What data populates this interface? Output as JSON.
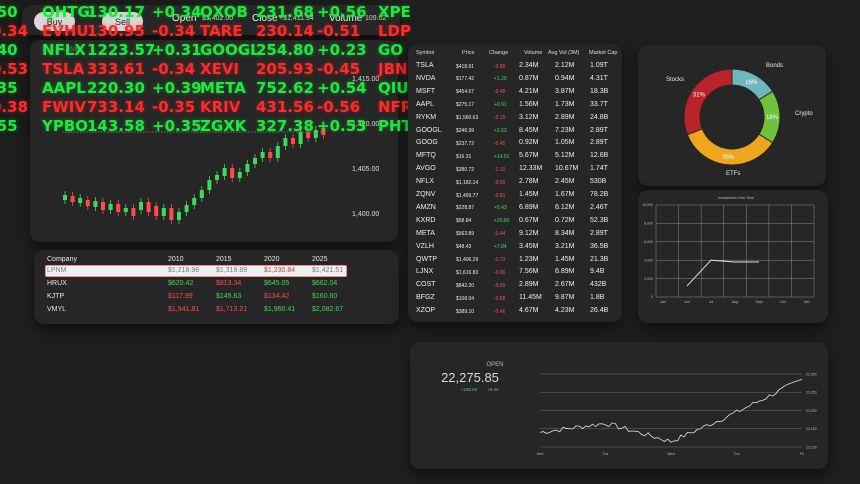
{
  "topbar": {
    "buy_label": "Buy",
    "sell_label": "Sell",
    "open_label": "Open",
    "open_value": "$1,402.00",
    "close_label": "Close",
    "close_value": "+$1,411.94",
    "volume_label": "Volume",
    "volume_value": "109.02"
  },
  "candle_chart": {
    "title": "LPNM",
    "price_ticks": [
      "1,415.00",
      "1,410.00",
      "1,405.00",
      "1,400.00"
    ]
  },
  "company_table": {
    "headers": [
      "Company",
      "2010",
      "2015",
      "2020",
      "2025"
    ],
    "rows": [
      {
        "name": "LPNM",
        "v": [
          "$1,218.98",
          "$1,319.89",
          "$1,230.84",
          "$1,421.51"
        ],
        "c": [
          "g",
          "g",
          "r",
          "g"
        ]
      },
      {
        "name": "HRUX",
        "v": [
          "$620.42",
          "$813.34",
          "$645.05",
          "$662.04"
        ],
        "c": [
          "g",
          "r",
          "g",
          "g"
        ]
      },
      {
        "name": "KJTP",
        "v": [
          "$117.99",
          "$145.63",
          "$134.42",
          "$160.60"
        ],
        "c": [
          "r",
          "g",
          "r",
          "g"
        ]
      },
      {
        "name": "VMYL",
        "v": [
          "$1,941.81",
          "$1,713.21",
          "$1,960.41",
          "$2,082.67"
        ],
        "c": [
          "r",
          "r",
          "g",
          "g"
        ]
      }
    ]
  },
  "ticker": {
    "rows": [
      [
        [
          ".50",
          "g"
        ],
        [
          "QHTG",
          "g"
        ],
        [
          "130.17",
          "g"
        ],
        [
          "+0.34",
          "g"
        ],
        [
          "QXOB",
          "g"
        ],
        [
          "231.68",
          "g"
        ],
        [
          "+0.56",
          "g"
        ],
        [
          "XPE",
          "g"
        ]
      ],
      [
        [
          "0.34",
          "r"
        ],
        [
          "EVHU",
          "r"
        ],
        [
          "130.95",
          "r"
        ],
        [
          "-0.34",
          "r"
        ],
        [
          "TARE",
          "r"
        ],
        [
          "230.14",
          "r"
        ],
        [
          "-0.51",
          "r"
        ],
        [
          "LDP",
          "r"
        ]
      ],
      [
        [
          ".40",
          "g"
        ],
        [
          "NFLX",
          "g"
        ],
        [
          "1223.57",
          "g"
        ],
        [
          "+0.31",
          "g"
        ],
        [
          "GOOGL",
          "g"
        ],
        [
          "254.80",
          "g"
        ],
        [
          "+0.23",
          "g"
        ],
        [
          "GO",
          "g"
        ]
      ],
      [
        [
          "0.53",
          "r"
        ],
        [
          "TSLA",
          "r"
        ],
        [
          "333.61",
          "r"
        ],
        [
          "-0.34",
          "r"
        ],
        [
          "XEVI",
          "r"
        ],
        [
          "205.93",
          "r"
        ],
        [
          "-0.45",
          "r"
        ],
        [
          "JBN",
          "r"
        ]
      ],
      [
        [
          ".35",
          "g"
        ],
        [
          "AAPL",
          "g"
        ],
        [
          "220.30",
          "g"
        ],
        [
          "+0.39",
          "g"
        ],
        [
          "META",
          "g"
        ],
        [
          "752.62",
          "g"
        ],
        [
          "+0.54",
          "g"
        ],
        [
          "QIU",
          "g"
        ]
      ],
      [
        [
          "0.38",
          "r"
        ],
        [
          "FWIV",
          "r"
        ],
        [
          "733.14",
          "r"
        ],
        [
          "-0.35",
          "r"
        ],
        [
          "KRIV",
          "r"
        ],
        [
          "431.56",
          "r"
        ],
        [
          "-0.56",
          "r"
        ],
        [
          "NFR",
          "r"
        ]
      ],
      [
        [
          ".55",
          "g"
        ],
        [
          "YPBO",
          "g"
        ],
        [
          "143.58",
          "g"
        ],
        [
          "+0.35",
          "g"
        ],
        [
          "ZGXK",
          "g"
        ],
        [
          "327.38",
          "g"
        ],
        [
          "+0.53",
          "g"
        ],
        [
          "PHT",
          "g"
        ]
      ]
    ]
  },
  "stock_list": {
    "headers": [
      "Symbol",
      "Price",
      "Change",
      "Volume",
      "Avg Vol (3M)",
      "Market Cap"
    ],
    "rows": [
      [
        "TSLA",
        "$418.61",
        "-0.85",
        "r",
        "2.34M",
        "2.12M",
        "1.09T"
      ],
      [
        "NVDA",
        "$177.42",
        "+1.29",
        "g",
        "0.87M",
        "0.94M",
        "4.31T"
      ],
      [
        "MSFT",
        "$454.67",
        "-0.48",
        "r",
        "4.21M",
        "3.87M",
        "18.3B"
      ],
      [
        "AAPL",
        "$275.17",
        "+0.91",
        "g",
        "1.56M",
        "1.73M",
        "33.7T"
      ],
      [
        "RYKM",
        "$1,560.63",
        "-0.15",
        "r",
        "3.12M",
        "2.89M",
        "24.8B"
      ],
      [
        "GOOGL",
        "$246.99",
        "+2.63",
        "g",
        "8.45M",
        "7.23M",
        "2.89T"
      ],
      [
        "GOOG",
        "$237.72",
        "-0.45",
        "r",
        "0.92M",
        "1.05M",
        "2.89T"
      ],
      [
        "MFTQ",
        "$16.31",
        "+14.51",
        "g",
        "5.67M",
        "5.12M",
        "12.6B"
      ],
      [
        "AVGO",
        "$380.72",
        "-1.10",
        "r",
        "12.33M",
        "10.67M",
        "1.74T"
      ],
      [
        "NFLX",
        "$1,182.14",
        "-0.69",
        "r",
        "2.78M",
        "2.45M",
        "530B"
      ],
      [
        "ZQNV",
        "$1,409.77",
        "-0.81",
        "r",
        "1.45M",
        "1.67M",
        "78.2B"
      ],
      [
        "AMZN",
        "$228.87",
        "+5.43",
        "g",
        "6.89M",
        "6.12M",
        "2.46T"
      ],
      [
        "KXRD",
        "$58.84",
        "+20.80",
        "g",
        "0.67M",
        "0.72M",
        "52.3B"
      ],
      [
        "META",
        "$563.89",
        "-0.44",
        "r",
        "9.12M",
        "8.34M",
        "2.89T"
      ],
      [
        "VZLH",
        "$48.43",
        "+7.84",
        "g",
        "3.45M",
        "3.21M",
        "36.5B"
      ],
      [
        "QWTP",
        "$1,406.29",
        "-0.73",
        "r",
        "1.23M",
        "1.45M",
        "21.3B"
      ],
      [
        "LJNX",
        "$1,616.83",
        "-0.96",
        "r",
        "7.56M",
        "6.89M",
        "9.4B"
      ],
      [
        "COST",
        "$842.20",
        "-0.69",
        "r",
        "2.89M",
        "2.67M",
        "432B"
      ],
      [
        "BFGZ",
        "$108.04",
        "-0.58",
        "r",
        "11.45M",
        "9.87M",
        "1.8B"
      ],
      [
        "XZOP",
        "$389.10",
        "-0.46",
        "r",
        "4.67M",
        "4.23M",
        "26.4B"
      ]
    ]
  },
  "donut": {
    "labels": {
      "stocks": "Stocks",
      "bonds": "Bonds",
      "crypto": "Crypto",
      "etfs": "ETFs"
    },
    "slices": [
      {
        "name": "Bonds",
        "value": 16,
        "label": "16%",
        "color": "#6fb7c0"
      },
      {
        "name": "Crypto",
        "value": 18,
        "label": "18%",
        "color": "#6fc23a"
      },
      {
        "name": "ETFs",
        "value": 35,
        "label": "35%",
        "color": "#f0a51e"
      },
      {
        "name": "Stocks",
        "value": 31,
        "label": "31%",
        "color": "#b8242a"
      }
    ]
  },
  "line_chart": {
    "title": "Investments Over Time",
    "y_ticks": [
      "10,000",
      "8,000",
      "6,000",
      "4,000",
      "2,000",
      "0"
    ],
    "x_ticks": [
      "Jan",
      "Jun",
      "Jul",
      "Aug",
      "Sept",
      "Oct",
      "Dec"
    ]
  },
  "open_chart": {
    "label": "OPEN",
    "value": "22,275.85",
    "change1": "+195.63",
    "change2": "+8.45",
    "y_ticks": [
      "22,300",
      "22,250",
      "22,200",
      "22,150",
      "22,100"
    ],
    "x_ticks": [
      "Mon",
      "Tue",
      "Wed",
      "Thu",
      "Fri"
    ]
  },
  "colors": {
    "positive": "#3ed95a",
    "negative": "#ff4b4b",
    "panel": "#262626",
    "background": "#1f1f1f"
  },
  "chart_data": [
    {
      "type": "line",
      "title": "Investments Over Time",
      "x": [
        "Jun",
        "Jul",
        "Aug",
        "Sept"
      ],
      "series": [
        {
          "values": [
            1200,
            4000,
            3800,
            3800
          ]
        }
      ],
      "ylim": [
        0,
        10000
      ]
    },
    {
      "type": "line",
      "x": [
        "Mon",
        "Tue",
        "Wed",
        "Thu",
        "Fri"
      ],
      "series": [
        {
          "values": [
            22140,
            22165,
            22115,
            22195,
            22285
          ]
        }
      ],
      "ylim": [
        22100,
        22300
      ]
    },
    {
      "type": "pie",
      "categories": [
        "Bonds",
        "Crypto",
        "ETFs",
        "Stocks"
      ],
      "values": [
        16,
        18,
        35,
        31
      ]
    }
  ]
}
